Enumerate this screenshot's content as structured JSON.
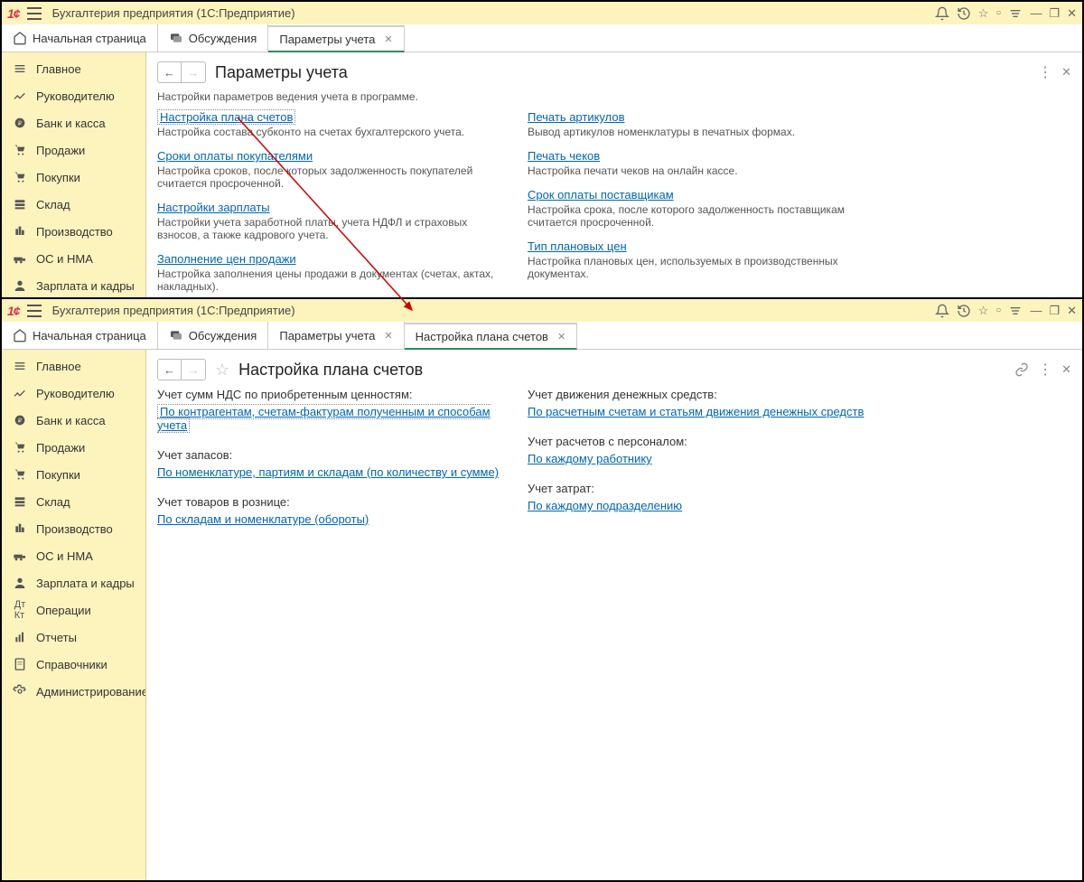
{
  "app_title": "Бухгалтерия предприятия  (1С:Предприятие)",
  "tabs_top": {
    "home": "Начальная страница",
    "discuss": "Обсуждения",
    "params": "Параметры учета"
  },
  "sidebar": [
    "Главное",
    "Руководителю",
    "Банк и касса",
    "Продажи",
    "Покупки",
    "Склад",
    "Производство",
    "ОС и НМА",
    "Зарплата и кадры"
  ],
  "sidebar_full": [
    "Главное",
    "Руководителю",
    "Банк и касса",
    "Продажи",
    "Покупки",
    "Склад",
    "Производство",
    "ОС и НМА",
    "Зарплата и кадры",
    "Операции",
    "Отчеты",
    "Справочники",
    "Администрирование"
  ],
  "win1": {
    "title": "Параметры учета",
    "desc": "Настройки параметров ведения учета в программе.",
    "col1": [
      {
        "link": "Настройка плана счетов",
        "desc": "Настройка состава субконто на счетах бухгалтерского учета.",
        "boxed": true
      },
      {
        "link": "Сроки оплаты покупателями",
        "desc": "Настройка сроков, после которых задолженность покупателей считается просроченной."
      },
      {
        "link": "Настройки зарплаты",
        "desc": "Настройки учета заработной платы, учета НДФЛ и страховых взносов, а также кадрового учета."
      },
      {
        "link": "Заполнение цен продажи",
        "desc": "Настройка заполнения цены продажи в документах (счетах, актах, накладных)."
      }
    ],
    "col2": [
      {
        "link": "Печать артикулов",
        "desc": "Вывод артикулов номенклатуры в печатных формах."
      },
      {
        "link": "Печать чеков",
        "desc": "Настройка печати чеков на онлайн кассе."
      },
      {
        "link": "Срок оплаты поставщикам",
        "desc": "Настройка срока, после которого задолженность поставщикам считается просроченной."
      },
      {
        "link": "Тип плановых цен",
        "desc": "Настройка плановых цен, используемых в производственных документах."
      }
    ]
  },
  "tabs_bot": {
    "home": "Начальная страница",
    "discuss": "Обсуждения",
    "params": "Параметры учета",
    "plan": "Настройка плана счетов"
  },
  "win2": {
    "title": "Настройка плана счетов",
    "col1": [
      {
        "label": "Учет сумм НДС по приобретенным ценностям:",
        "link": "По контрагентам, счетам-фактурам полученным и способам учета",
        "boxed": true
      },
      {
        "label": "Учет запасов:",
        "link": "По номенклатуре, партиям и складам (по количеству и сумме)"
      },
      {
        "label": "Учет товаров в рознице:",
        "link": "По складам и номенклатуре (обороты)"
      }
    ],
    "col2": [
      {
        "label": "Учет движения денежных средств:",
        "link": "По расчетным счетам и статьям движения денежных средств"
      },
      {
        "label": "Учет расчетов с персоналом:",
        "link": "По каждому работнику"
      },
      {
        "label": "Учет затрат:",
        "link": "По каждому подразделению"
      }
    ]
  }
}
